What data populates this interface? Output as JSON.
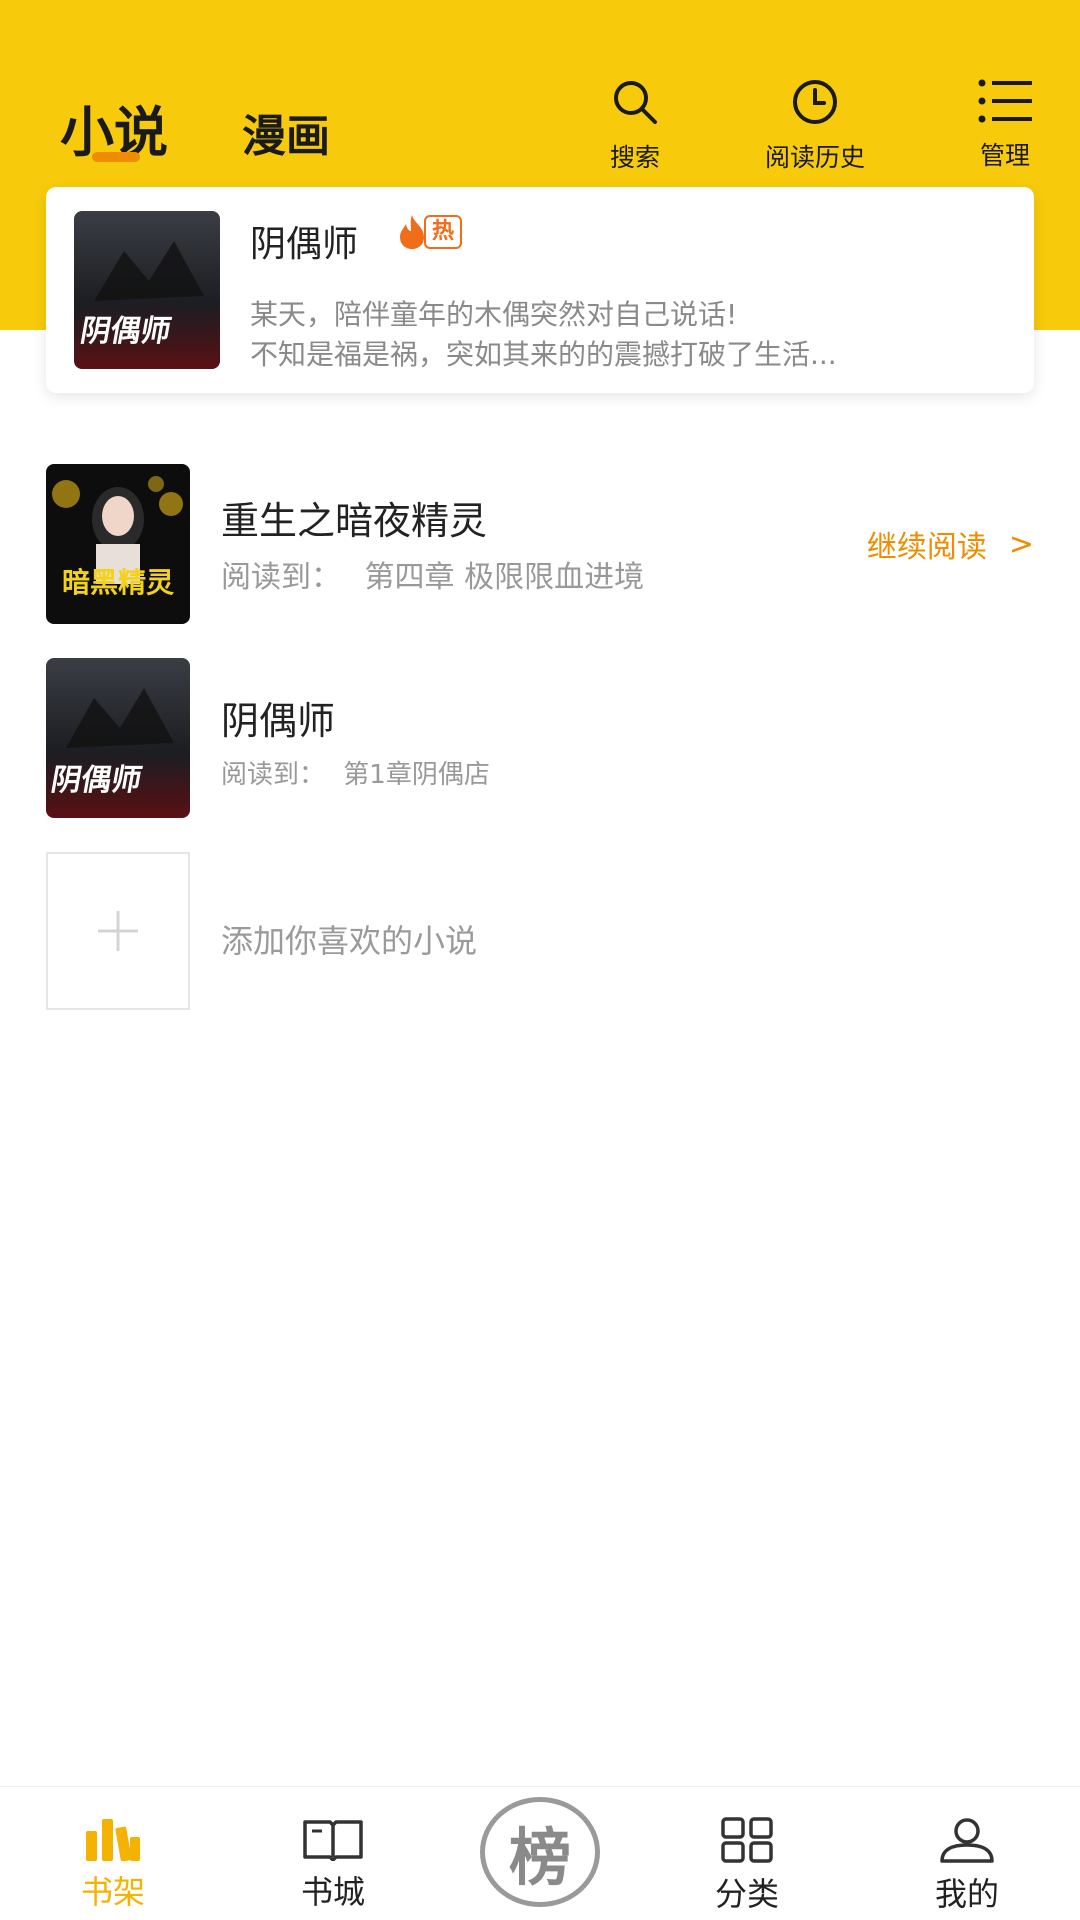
{
  "header": {
    "tabs": [
      {
        "label": "小说",
        "active": true
      },
      {
        "label": "漫画",
        "active": false
      }
    ],
    "actions": [
      {
        "icon": "search-icon",
        "label": "搜索"
      },
      {
        "icon": "clock-icon",
        "label": "阅读历史"
      },
      {
        "icon": "list-icon",
        "label": "管理"
      }
    ],
    "accent_color": "#f7cb0b"
  },
  "recommend": {
    "title": "阴偶师",
    "badge": "热",
    "desc_line1": "某天，陪伴童年的木偶突然对自己说话!",
    "desc_line2": "不知是福是祸，突如其来的的震撼打破了生活..."
  },
  "books": [
    {
      "title": "重生之暗夜精灵",
      "progress_label": "阅读到：",
      "progress_value": "第四章 极限限血进境",
      "continue_label": "继续阅读",
      "continue_arrow": ">"
    },
    {
      "title": "阴偶师",
      "progress_label": "阅读到：",
      "progress_value": "第1章阴偶店"
    }
  ],
  "add_book": {
    "text": "添加你喜欢的小说"
  },
  "bottom_nav": [
    {
      "icon": "bookshelf-icon",
      "label": "书架",
      "active": true
    },
    {
      "icon": "book-icon",
      "label": "书城",
      "active": false
    },
    {
      "icon": "ranking-icon",
      "label": "榜",
      "active": false
    },
    {
      "icon": "grid-icon",
      "label": "分类",
      "active": false
    },
    {
      "icon": "user-icon",
      "label": "我的",
      "active": false
    }
  ],
  "colors": {
    "active_nav": "#f4b301",
    "continue": "#ef8c00",
    "hot": "#f06d1a"
  }
}
